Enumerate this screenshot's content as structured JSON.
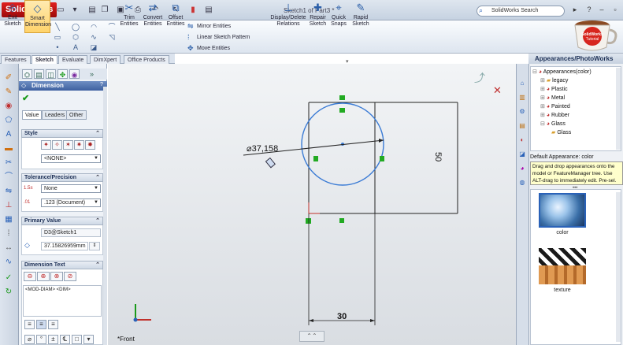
{
  "app": {
    "name": "SolidWorks",
    "doc_title": "Sketch1 of Part3 *"
  },
  "search": {
    "placeholder": "SolidWorks Search"
  },
  "ribbon": {
    "exit_sketch": "Exit Sketch",
    "smart_dimension": "Smart Dimension",
    "trim": "Trim Entities",
    "convert": "Convert Entities",
    "offset": "Offset Entities",
    "mirror": "Mirror Entities",
    "linear_pattern": "Linear Sketch Pattern",
    "move": "Move Entities",
    "display_delete": "Display/Delete Relations",
    "repair": "Repair Sketch",
    "quick_snaps": "Quick Snaps",
    "rapid_sketch": "Rapid Sketch",
    "logo_text": "SolidWorks Tutorial"
  },
  "tabs": [
    "Features",
    "Sketch",
    "Evaluate",
    "DimXpert",
    "Office Products"
  ],
  "pm": {
    "title": "Dimension",
    "subtabs": [
      "Value",
      "Leaders",
      "Other"
    ],
    "style_label": "Style",
    "style_value": "<NONE>",
    "tol_label": "Tolerance/Precision",
    "tol_value": "None",
    "precision_value": ".123 (Document)",
    "primary_label": "Primary Value",
    "primary_name": "D3@Sketch1",
    "primary_value": "37.15826959mm",
    "dimtext_label": "Dimension Text",
    "dimtext_value": "<MOD-DIAM> <DIM>"
  },
  "canvas": {
    "dia_label": "⌀37,158",
    "dim_50": "50",
    "dim_30": "30",
    "view_label": "*Front"
  },
  "taskpane": {
    "title": "Appearances/PhotoWorks",
    "tree": [
      "Appearances(color)",
      "legacy",
      "Plastic",
      "Metal",
      "Painted",
      "Rubber",
      "Glass",
      "Glass"
    ],
    "default_appearance": "Default Appearance: color",
    "tip": "Drag and drop appearances onto the model or FeatureManager tree. Use ALT-drag to immediately edit. Pre-sel.",
    "swatches": [
      "color",
      "texture"
    ]
  }
}
